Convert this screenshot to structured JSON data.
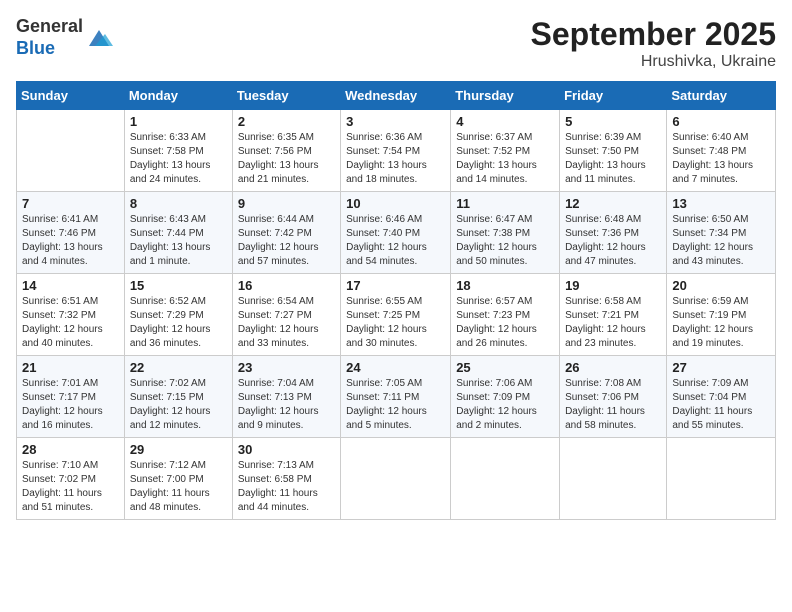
{
  "header": {
    "logo_general": "General",
    "logo_blue": "Blue",
    "title": "September 2025",
    "subtitle": "Hrushivka, Ukraine"
  },
  "calendar": {
    "days_of_week": [
      "Sunday",
      "Monday",
      "Tuesday",
      "Wednesday",
      "Thursday",
      "Friday",
      "Saturday"
    ],
    "weeks": [
      [
        {
          "day": "",
          "info": ""
        },
        {
          "day": "1",
          "info": "Sunrise: 6:33 AM\nSunset: 7:58 PM\nDaylight: 13 hours and 24 minutes."
        },
        {
          "day": "2",
          "info": "Sunrise: 6:35 AM\nSunset: 7:56 PM\nDaylight: 13 hours and 21 minutes."
        },
        {
          "day": "3",
          "info": "Sunrise: 6:36 AM\nSunset: 7:54 PM\nDaylight: 13 hours and 18 minutes."
        },
        {
          "day": "4",
          "info": "Sunrise: 6:37 AM\nSunset: 7:52 PM\nDaylight: 13 hours and 14 minutes."
        },
        {
          "day": "5",
          "info": "Sunrise: 6:39 AM\nSunset: 7:50 PM\nDaylight: 13 hours and 11 minutes."
        },
        {
          "day": "6",
          "info": "Sunrise: 6:40 AM\nSunset: 7:48 PM\nDaylight: 13 hours and 7 minutes."
        }
      ],
      [
        {
          "day": "7",
          "info": "Sunrise: 6:41 AM\nSunset: 7:46 PM\nDaylight: 13 hours and 4 minutes."
        },
        {
          "day": "8",
          "info": "Sunrise: 6:43 AM\nSunset: 7:44 PM\nDaylight: 13 hours and 1 minute."
        },
        {
          "day": "9",
          "info": "Sunrise: 6:44 AM\nSunset: 7:42 PM\nDaylight: 12 hours and 57 minutes."
        },
        {
          "day": "10",
          "info": "Sunrise: 6:46 AM\nSunset: 7:40 PM\nDaylight: 12 hours and 54 minutes."
        },
        {
          "day": "11",
          "info": "Sunrise: 6:47 AM\nSunset: 7:38 PM\nDaylight: 12 hours and 50 minutes."
        },
        {
          "day": "12",
          "info": "Sunrise: 6:48 AM\nSunset: 7:36 PM\nDaylight: 12 hours and 47 minutes."
        },
        {
          "day": "13",
          "info": "Sunrise: 6:50 AM\nSunset: 7:34 PM\nDaylight: 12 hours and 43 minutes."
        }
      ],
      [
        {
          "day": "14",
          "info": "Sunrise: 6:51 AM\nSunset: 7:32 PM\nDaylight: 12 hours and 40 minutes."
        },
        {
          "day": "15",
          "info": "Sunrise: 6:52 AM\nSunset: 7:29 PM\nDaylight: 12 hours and 36 minutes."
        },
        {
          "day": "16",
          "info": "Sunrise: 6:54 AM\nSunset: 7:27 PM\nDaylight: 12 hours and 33 minutes."
        },
        {
          "day": "17",
          "info": "Sunrise: 6:55 AM\nSunset: 7:25 PM\nDaylight: 12 hours and 30 minutes."
        },
        {
          "day": "18",
          "info": "Sunrise: 6:57 AM\nSunset: 7:23 PM\nDaylight: 12 hours and 26 minutes."
        },
        {
          "day": "19",
          "info": "Sunrise: 6:58 AM\nSunset: 7:21 PM\nDaylight: 12 hours and 23 minutes."
        },
        {
          "day": "20",
          "info": "Sunrise: 6:59 AM\nSunset: 7:19 PM\nDaylight: 12 hours and 19 minutes."
        }
      ],
      [
        {
          "day": "21",
          "info": "Sunrise: 7:01 AM\nSunset: 7:17 PM\nDaylight: 12 hours and 16 minutes."
        },
        {
          "day": "22",
          "info": "Sunrise: 7:02 AM\nSunset: 7:15 PM\nDaylight: 12 hours and 12 minutes."
        },
        {
          "day": "23",
          "info": "Sunrise: 7:04 AM\nSunset: 7:13 PM\nDaylight: 12 hours and 9 minutes."
        },
        {
          "day": "24",
          "info": "Sunrise: 7:05 AM\nSunset: 7:11 PM\nDaylight: 12 hours and 5 minutes."
        },
        {
          "day": "25",
          "info": "Sunrise: 7:06 AM\nSunset: 7:09 PM\nDaylight: 12 hours and 2 minutes."
        },
        {
          "day": "26",
          "info": "Sunrise: 7:08 AM\nSunset: 7:06 PM\nDaylight: 11 hours and 58 minutes."
        },
        {
          "day": "27",
          "info": "Sunrise: 7:09 AM\nSunset: 7:04 PM\nDaylight: 11 hours and 55 minutes."
        }
      ],
      [
        {
          "day": "28",
          "info": "Sunrise: 7:10 AM\nSunset: 7:02 PM\nDaylight: 11 hours and 51 minutes."
        },
        {
          "day": "29",
          "info": "Sunrise: 7:12 AM\nSunset: 7:00 PM\nDaylight: 11 hours and 48 minutes."
        },
        {
          "day": "30",
          "info": "Sunrise: 7:13 AM\nSunset: 6:58 PM\nDaylight: 11 hours and 44 minutes."
        },
        {
          "day": "",
          "info": ""
        },
        {
          "day": "",
          "info": ""
        },
        {
          "day": "",
          "info": ""
        },
        {
          "day": "",
          "info": ""
        }
      ]
    ]
  }
}
